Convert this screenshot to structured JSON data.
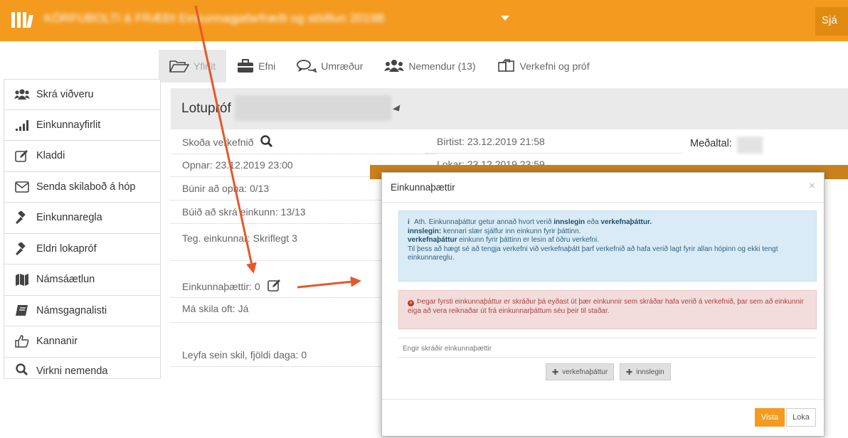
{
  "topbar": {
    "course_title": "KÖRFUBOLTI & FRÆÐI Einkunnagjafarfræði og stöðlun 2019B",
    "right_button": "Sjá"
  },
  "tabs": [
    {
      "label": "Yfirlit",
      "icon": "folder-open-icon",
      "active": true
    },
    {
      "label": "Efni",
      "icon": "briefcase-icon",
      "active": false
    },
    {
      "label": "Umræður",
      "icon": "comments-icon",
      "active": false
    },
    {
      "label": "Nemendur (13)",
      "icon": "users-icon",
      "active": false
    },
    {
      "label": "Verkefni og próf",
      "icon": "copy-icon",
      "active": false
    }
  ],
  "sidebar": {
    "items": [
      {
        "label": "Skrá viðveru",
        "icon": "users-icon"
      },
      {
        "label": "Einkunnayfirlit",
        "icon": "signal-icon"
      },
      {
        "label": "Kladdi",
        "icon": "edit-icon"
      },
      {
        "label": "Senda skilaboð á hóp",
        "icon": "envelope-icon"
      },
      {
        "label": "Einkunnaregla",
        "icon": "gavel-icon"
      },
      {
        "label": "Eldri lokapróf",
        "icon": "gavel-icon"
      },
      {
        "label": "Námsáætlun",
        "icon": "map-icon"
      },
      {
        "label": "Námsgagnalisti",
        "icon": "book-icon"
      },
      {
        "label": "Kannanir",
        "icon": "thumbs-up-icon"
      },
      {
        "label": "Virkni nemenda",
        "icon": "search-icon"
      }
    ]
  },
  "assignment": {
    "title": "Lotupróf",
    "view_label": "Skoða verkefnið",
    "opens": "Opnar: 23.12.2019 23:00",
    "done_opening": "Búnir að opna: 0/13",
    "graded": "Búið að skrá einkunn: 13/13",
    "grade_type": "Teg. einkunnar: Skriflegt 3",
    "grade_parts": "Einkunnaþættir: 0",
    "resubmit": "Má skila oft: Já",
    "late": "Leyfa sein skil, fjöldi daga: 0",
    "published": "Birtist: 23.12.2019 21:58",
    "closes": "Lokar: 23.12.2019 23:59",
    "average_label": "Meðaltal:"
  },
  "modal": {
    "title": "Einkunnaþættir",
    "close": "×",
    "info_line1_pre": "Ath. Einkunnaþáttur getur annað hvort verið ",
    "info_line1_b1": "innslegin",
    "info_line1_mid": " eða ",
    "info_line1_b2": "verkefnaþáttur.",
    "info_line2_b": "innslegin:",
    "info_line2": " kennari slær sjálfur inn einkunn fyrir þáttinn.",
    "info_line3_b": "verkefnaþáttur",
    "info_line3": " einkunn fyrir þáttinn er lesin af öðru verkefni.",
    "info_line4": "Til þess að hægt sé að tengja verkefni við verkefnaþátt þarf verkefnið að hafa verið lagt fyrir allan hópinn og ekki tengt einkunnareglu.",
    "danger_text": "Þegar fyrsti einkunnaþáttur er skráður þá eyðast út þær einkunnir sem skráðar hafa verið á verkefnið, þar sem að einkunnir eiga að vera reiknaðar út frá einkunnarþáttum séu þeir til staðar.",
    "empty_text": "Engir skráðir einkunnaþættir",
    "btn_project": "verkefnaþáttur",
    "btn_manual": "innslegin",
    "btn_save": "Vista",
    "btn_close": "Loka"
  },
  "colors": {
    "brand": "#f39a1f",
    "annotation_arrow": "#e5582b"
  }
}
